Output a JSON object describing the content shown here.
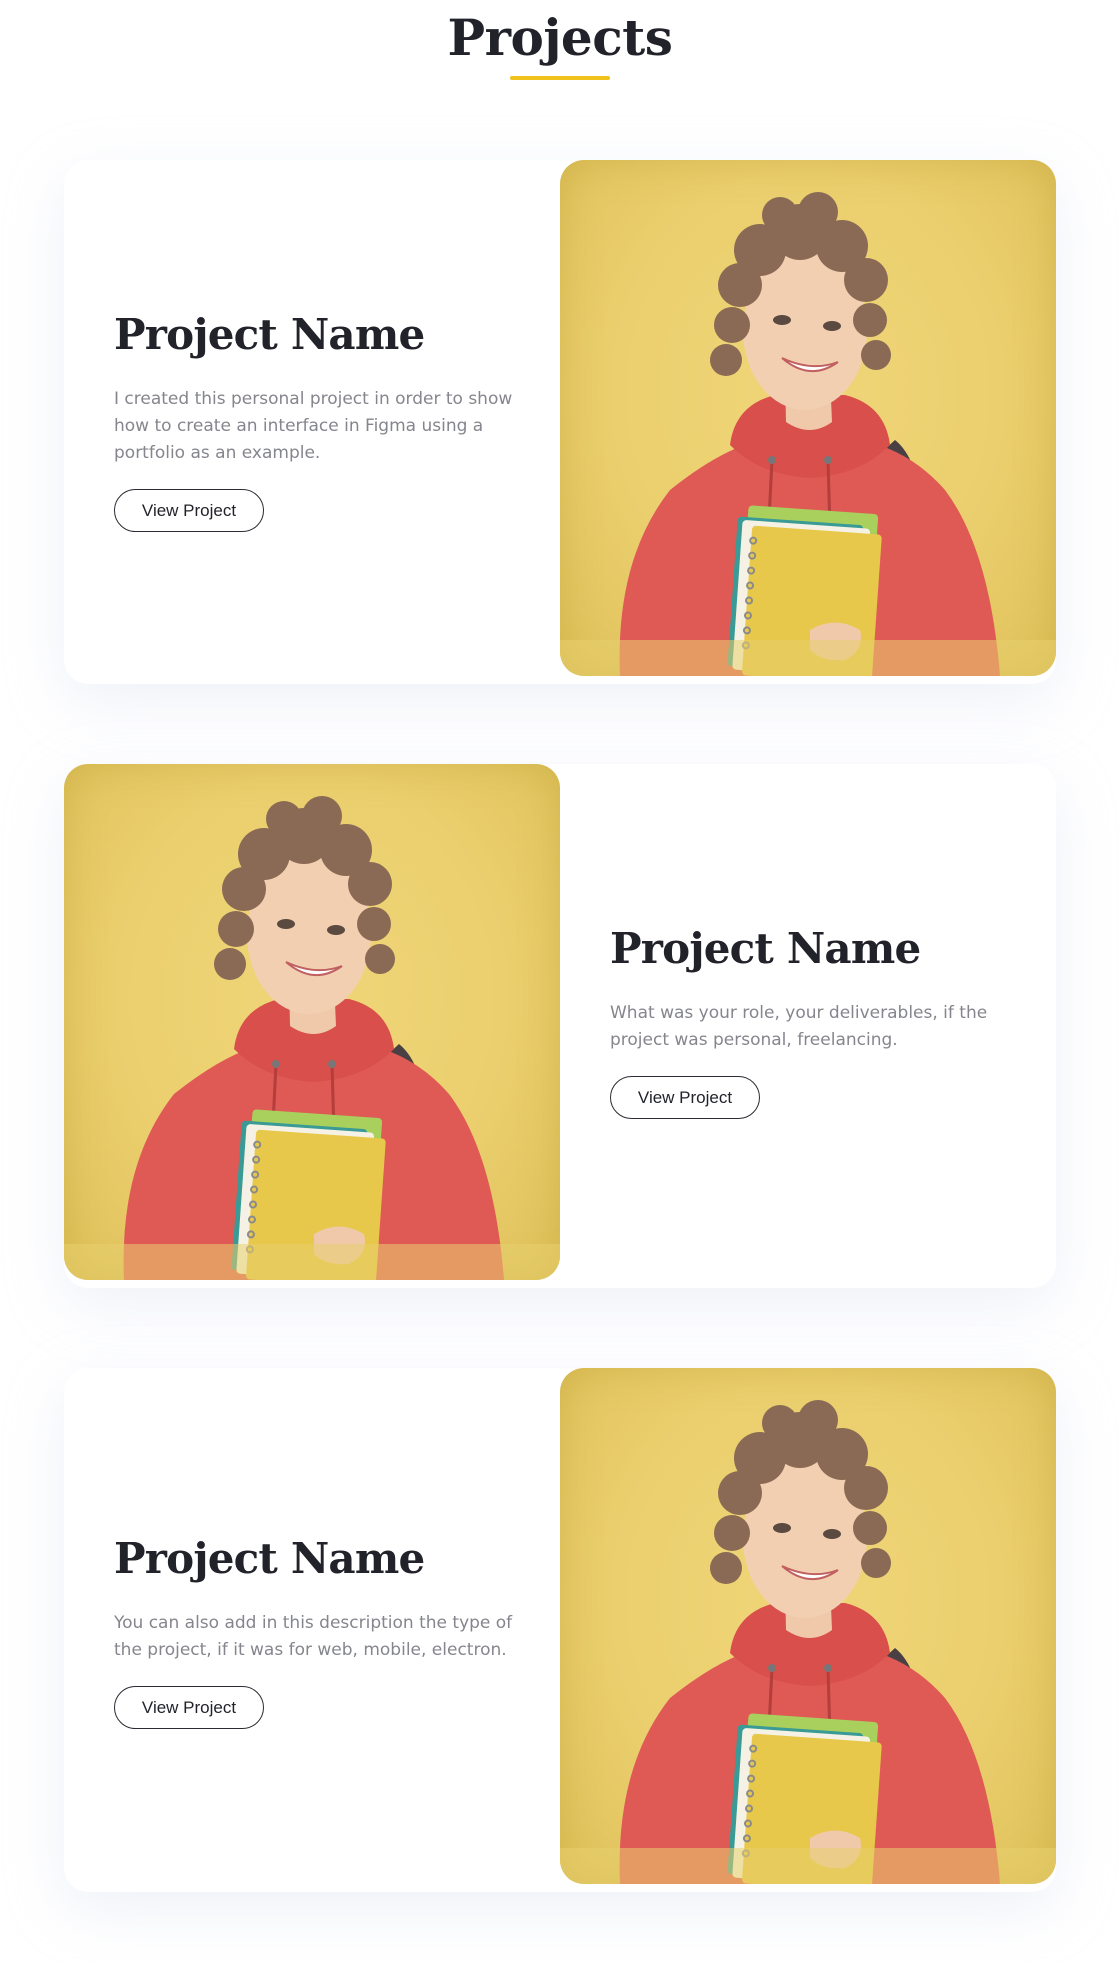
{
  "section": {
    "title": "Projects",
    "accent_color": "#f1c21b"
  },
  "projects": [
    {
      "name": "Project Name",
      "description": "I created this personal project in order to show how to create an interface in Figma using a portfolio as an example.",
      "button_label": "View Project",
      "image": "photo-student-with-notebooks",
      "image_side": "right"
    },
    {
      "name": "Project Name",
      "description": "What was your role, your deliverables, if the project was personal, freelancing.",
      "button_label": "View Project",
      "image": "photo-student-with-notebooks",
      "image_side": "left"
    },
    {
      "name": "Project Name",
      "description": "You can also add in this description the type of the project, if it was for web, mobile, electron.",
      "button_label": "View Project",
      "image": "photo-student-with-notebooks",
      "image_side": "right"
    }
  ]
}
